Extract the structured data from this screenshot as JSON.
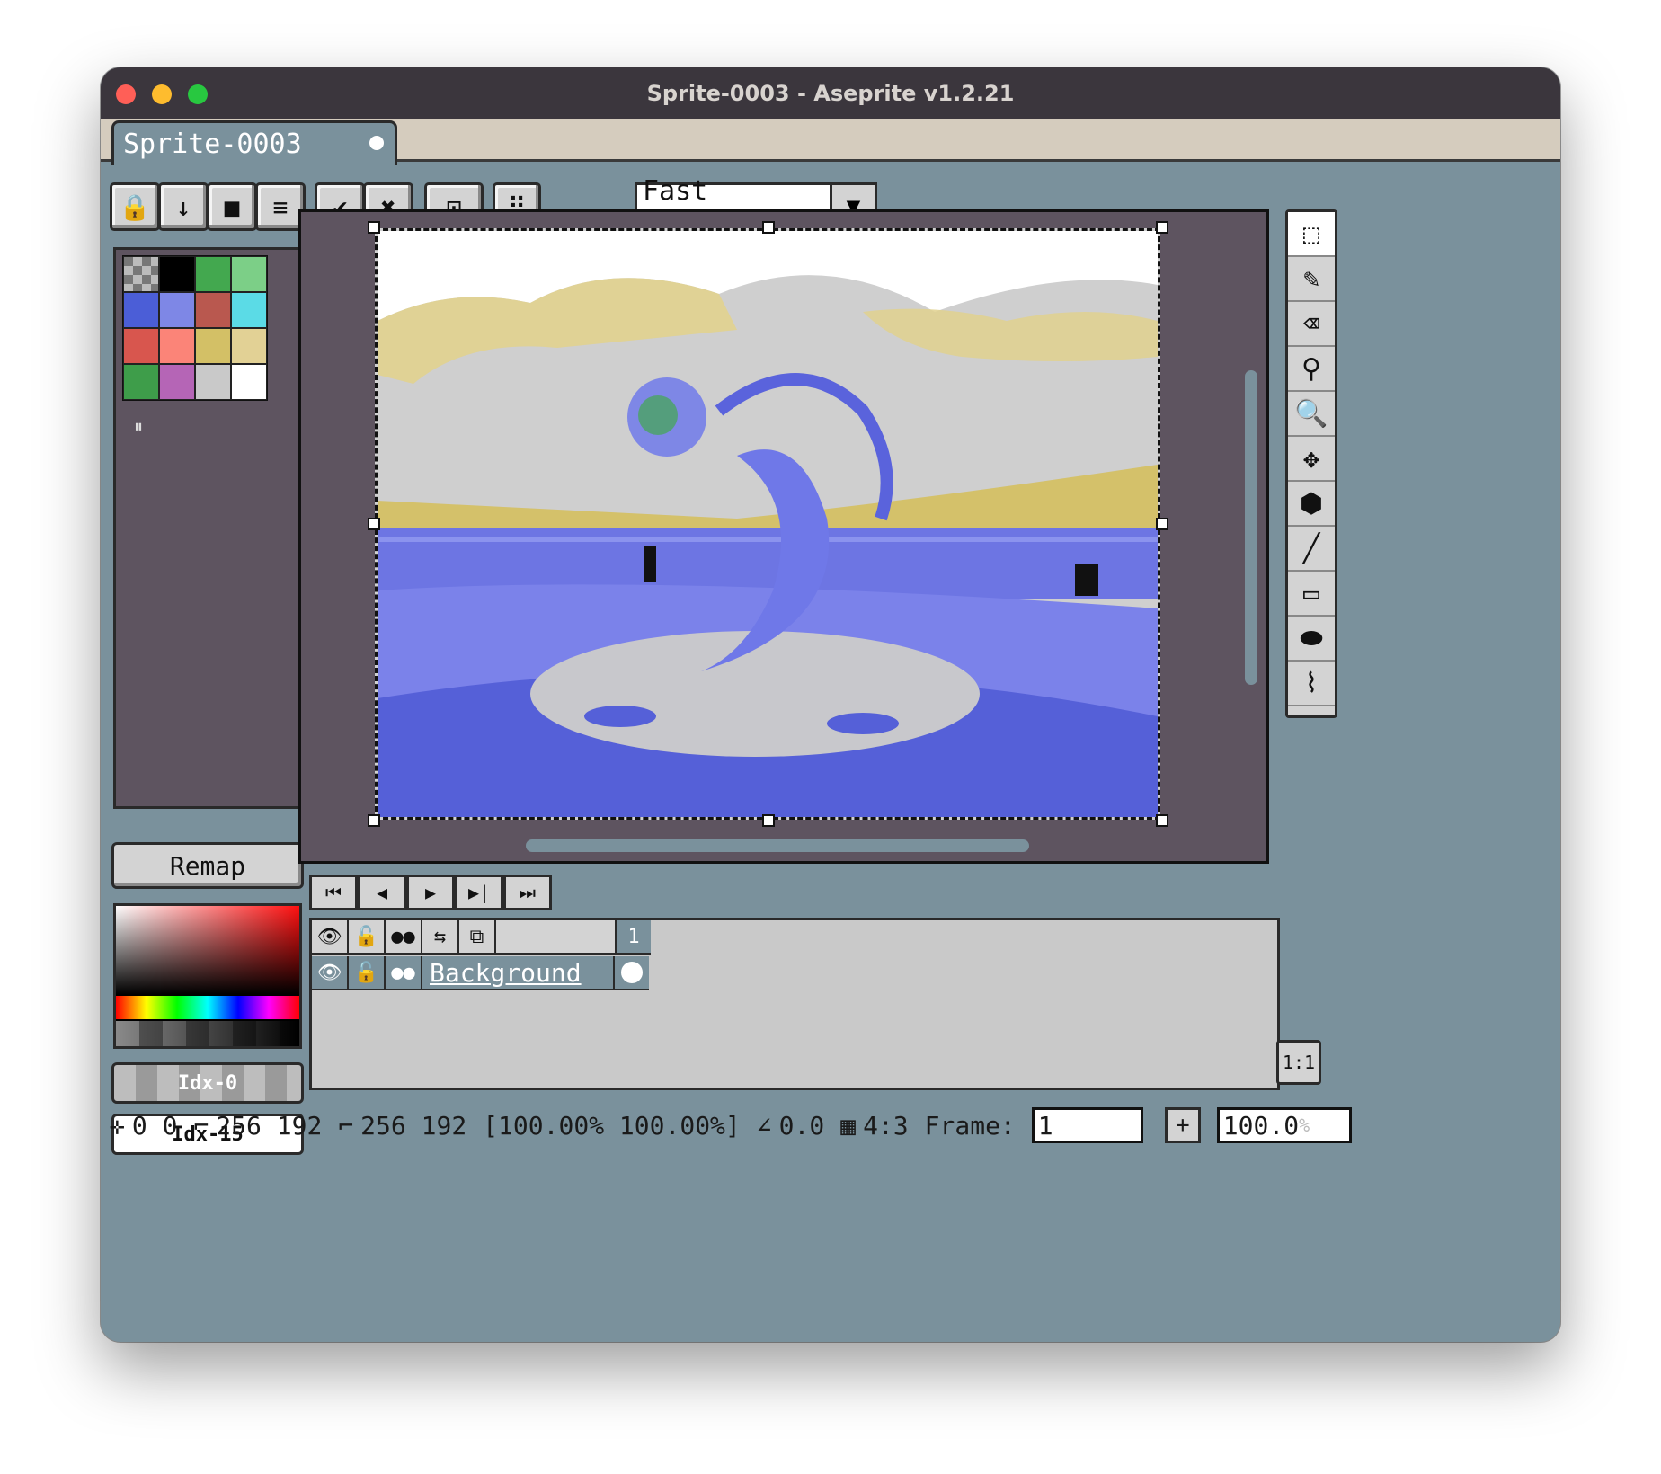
{
  "window": {
    "title": "Sprite-0003 - Aseprite v1.2.21"
  },
  "tabs": [
    {
      "label": "Sprite-0003",
      "modified": true
    }
  ],
  "context_bar": {
    "buttons": [
      {
        "name": "lock",
        "glyph": "🔒"
      },
      {
        "name": "arrow-down",
        "glyph": "↓"
      },
      {
        "name": "square",
        "glyph": "■"
      },
      {
        "name": "menu",
        "glyph": "≡"
      },
      {
        "name": "apply",
        "glyph": "✔"
      },
      {
        "name": "cancel",
        "glyph": "✖"
      },
      {
        "name": "pivot",
        "glyph": "⊡"
      },
      {
        "name": "grid",
        "glyph": "⠿"
      }
    ],
    "rotation_algorithm": "Fast Rotation"
  },
  "palette": {
    "colors": [
      "transparent",
      "#000000",
      "#43a84f",
      "#7ccf87",
      "#4b5ed7",
      "#7e87e6",
      "#b9584f",
      "#5bdbe6",
      "#d8564e",
      "#fb8478",
      "#d3c066",
      "#e2d195",
      "#3e9d4a",
      "#b565b6",
      "#c9c9c9",
      "#ffffff"
    ],
    "handle": "⏸"
  },
  "remap_label": "Remap",
  "foreground_color": "Idx-0",
  "background_color": "Idx-15",
  "tools": [
    {
      "name": "rectangular-marquee",
      "glyph": "⬚"
    },
    {
      "name": "pencil",
      "glyph": "✎"
    },
    {
      "name": "eraser",
      "glyph": "⌫"
    },
    {
      "name": "eyedropper",
      "glyph": "⚲"
    },
    {
      "name": "zoom",
      "glyph": "🔍"
    },
    {
      "name": "move",
      "glyph": "✥"
    },
    {
      "name": "paint-bucket",
      "glyph": "⬢"
    },
    {
      "name": "line",
      "glyph": "╱"
    },
    {
      "name": "rectangle",
      "glyph": "▭"
    },
    {
      "name": "contour",
      "glyph": "⬬"
    },
    {
      "name": "blur",
      "glyph": "⌇"
    }
  ],
  "playback": [
    "⏮",
    "◀",
    "▶",
    "▶|",
    "⏭"
  ],
  "timeline": {
    "header_icons": [
      "👁",
      "🔓",
      "●●",
      "⇆",
      "⧉"
    ],
    "frame_number": "1",
    "layers": [
      {
        "name": "Background",
        "icons": [
          "👁",
          "🔓",
          "●●"
        ]
      }
    ],
    "zoom_label": "1:1"
  },
  "status": {
    "cursor": "0 0",
    "size": "256 192",
    "size2": "256 192",
    "scale": "[100.00% 100.00%]",
    "angle": "0.0",
    "ratio": "4:3",
    "frame_label": "Frame:",
    "frame_value": "1",
    "zoom": "100.0",
    "zoom_suffix": "%"
  },
  "colors": {
    "chrome": "#7a919c",
    "editor_bg": "#5e5460",
    "button": "#d3d3d3",
    "titlebar": "#3b363d"
  }
}
